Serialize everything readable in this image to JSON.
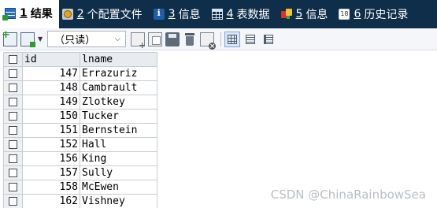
{
  "tabs": [
    {
      "num": "1",
      "label": "结果",
      "icon": "result-grid-icon",
      "active": true
    },
    {
      "num": "2",
      "label": "个配置文件",
      "icon": "profile-config-icon",
      "active": false
    },
    {
      "num": "3",
      "label": "信息",
      "icon": "info-icon",
      "active": false
    },
    {
      "num": "4",
      "label": "表数据",
      "icon": "table-data-icon",
      "active": false
    },
    {
      "num": "5",
      "label": "信息",
      "icon": "info-color-icon",
      "active": false
    },
    {
      "num": "6",
      "label": "历史记录",
      "icon": "history-calendar-icon",
      "active": false
    }
  ],
  "toolbar": {
    "mode_value": "（只读）",
    "active_view": "grid"
  },
  "table": {
    "columns": [
      "id",
      "lname"
    ],
    "rows": [
      {
        "id": "147",
        "lname": "Errazuriz"
      },
      {
        "id": "148",
        "lname": "Cambrault"
      },
      {
        "id": "149",
        "lname": "Zlotkey"
      },
      {
        "id": "150",
        "lname": "Tucker"
      },
      {
        "id": "151",
        "lname": "Bernstein"
      },
      {
        "id": "152",
        "lname": "Hall"
      },
      {
        "id": "156",
        "lname": "King"
      },
      {
        "id": "157",
        "lname": "Sully"
      },
      {
        "id": "158",
        "lname": "McEwen"
      },
      {
        "id": "162",
        "lname": "Vishney"
      }
    ]
  },
  "watermark": "CSDN @ChinaRainbowSea",
  "colors": {
    "tabbar_bg": "#0f2e4a",
    "toolbar_bg": "#f4f6f9",
    "grid_border": "#c6ccd3"
  }
}
